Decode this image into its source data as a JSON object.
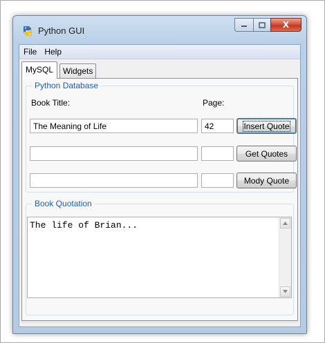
{
  "window": {
    "title": "Python GUI",
    "close_glyph": "X",
    "icon": "python-icon"
  },
  "menu": {
    "items": [
      "File",
      "Help"
    ]
  },
  "tabs": [
    {
      "label": "MySQL",
      "active": true
    },
    {
      "label": "Widgets",
      "active": false
    }
  ],
  "database_group": {
    "title": "Python Database",
    "book_title_label": "Book Title:",
    "page_label": "Page:",
    "rows": [
      {
        "title": "The Meaning of Life",
        "page": "42",
        "button": "Insert Quote"
      },
      {
        "title": "",
        "page": "",
        "button": "Get Quotes"
      },
      {
        "title": "",
        "page": "",
        "button": "Mody Quote"
      }
    ]
  },
  "quotation_group": {
    "title": "Book Quotation",
    "text": "The life of Brian..."
  }
}
